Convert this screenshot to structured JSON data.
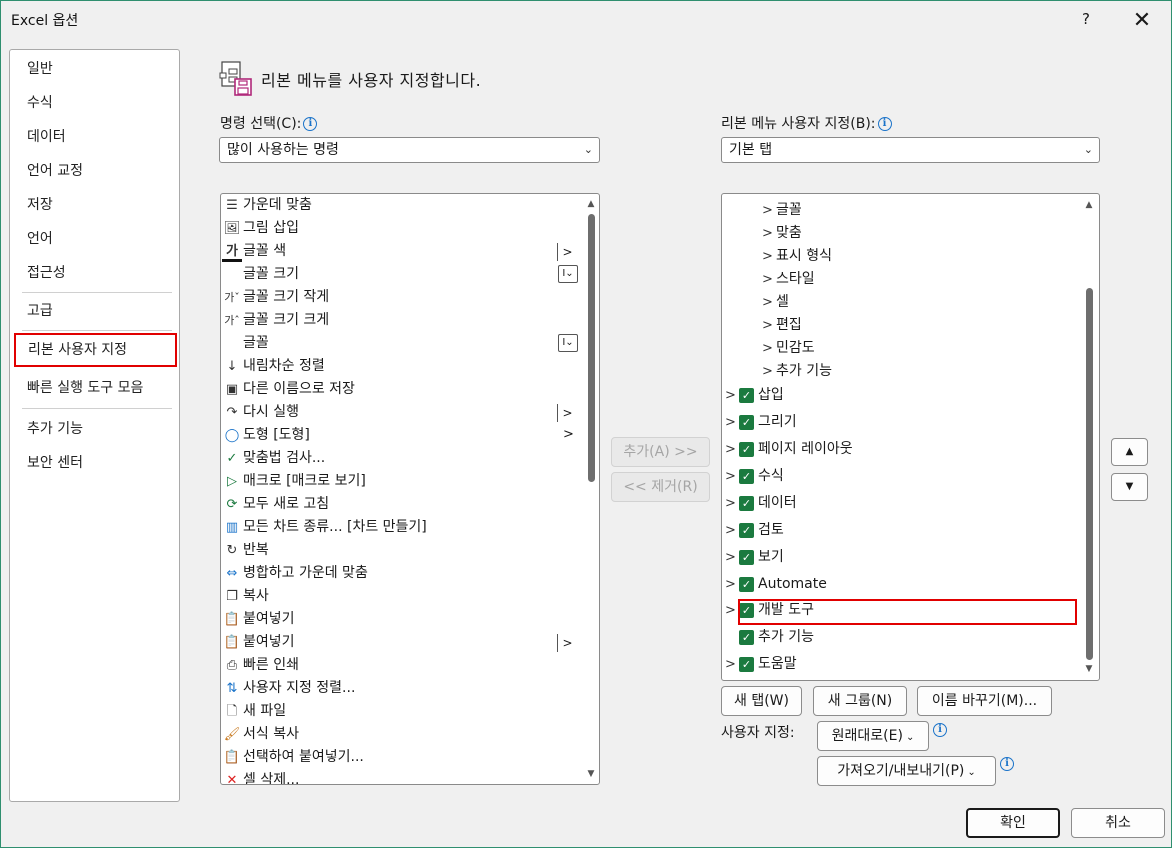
{
  "window": {
    "title": "Excel 옵션",
    "help": "?",
    "close": "✕"
  },
  "nav": {
    "items": [
      {
        "label": "일반"
      },
      {
        "label": "수식"
      },
      {
        "label": "데이터"
      },
      {
        "label": "언어 교정"
      },
      {
        "label": "저장"
      },
      {
        "label": "언어"
      },
      {
        "label": "접근성"
      },
      {
        "label": "고급"
      },
      {
        "label": "리본 사용자 지정"
      },
      {
        "label": "빠른 실행 도구 모음"
      },
      {
        "label": "추가 기능"
      },
      {
        "label": "보안 센터"
      }
    ],
    "selected": "리본 사용자 지정"
  },
  "header": {
    "text": "리본 메뉴를 사용자 지정합니다."
  },
  "commands": {
    "label": "명령 선택(C):",
    "dropdown_value": "많이 사용하는 명령",
    "items": [
      {
        "label": "가운데 맞춤",
        "icon": "align-center-icon",
        "glyph": "☰"
      },
      {
        "label": "그림 삽입",
        "icon": "insert-picture-icon",
        "glyph": "🖼"
      },
      {
        "label": "글꼴 색",
        "icon": "font-color-icon",
        "glyph": "가"
      },
      {
        "label": "글꼴 크기",
        "icon": "",
        "glyph": ""
      },
      {
        "label": "글꼴 크기 작게",
        "icon": "decrease-font-icon",
        "glyph": "가ˇ"
      },
      {
        "label": "글꼴 크기 크게",
        "icon": "increase-font-icon",
        "glyph": "가ˆ"
      },
      {
        "label": "글꼴",
        "icon": "",
        "glyph": ""
      },
      {
        "label": "내림차순 정렬",
        "icon": "sort-descending-icon",
        "glyph": "↓"
      },
      {
        "label": "다른 이름으로 저장",
        "icon": "save-as-icon",
        "glyph": "▣"
      },
      {
        "label": "다시 실행",
        "icon": "redo-icon",
        "glyph": "↷"
      },
      {
        "label": "도형 [도형]",
        "icon": "shapes-icon",
        "glyph": "◯"
      },
      {
        "label": "맞춤법 검사...",
        "icon": "spelling-icon",
        "glyph": "✓"
      },
      {
        "label": "매크로 [매크로 보기]",
        "icon": "macro-icon",
        "glyph": "▷"
      },
      {
        "label": "모두 새로 고침",
        "icon": "refresh-all-icon",
        "glyph": "⟳"
      },
      {
        "label": "모든 차트 종류... [차트 만들기]",
        "icon": "chart-icon",
        "glyph": "▥"
      },
      {
        "label": "반복",
        "icon": "repeat-icon",
        "glyph": "↻"
      },
      {
        "label": "병합하고 가운데 맞춤",
        "icon": "merge-center-icon",
        "glyph": "⇔"
      },
      {
        "label": "복사",
        "icon": "copy-icon",
        "glyph": "❐"
      },
      {
        "label": "붙여넣기",
        "icon": "paste-icon",
        "glyph": "📋"
      },
      {
        "label": "붙여넣기",
        "icon": "paste-icon",
        "glyph": "📋"
      },
      {
        "label": "빠른 인쇄",
        "icon": "quick-print-icon",
        "glyph": "⎙"
      },
      {
        "label": "사용자 지정 정렬...",
        "icon": "custom-sort-icon",
        "glyph": "⇅"
      },
      {
        "label": "새 파일",
        "icon": "new-file-icon",
        "glyph": "🗋"
      },
      {
        "label": "서식 복사",
        "icon": "format-painter-icon",
        "glyph": "🖌"
      },
      {
        "label": "선택하여 붙여넣기...",
        "icon": "paste-special-icon",
        "glyph": "📋"
      },
      {
        "label": "셀 삭제...",
        "icon": "delete-cells-icon",
        "glyph": "✕"
      }
    ]
  },
  "ribbon": {
    "label": "리본 메뉴 사용자 지정(B):",
    "dropdown_value": "기본 탭",
    "groups": [
      {
        "label": "글꼴"
      },
      {
        "label": "맞춤"
      },
      {
        "label": "표시 형식"
      },
      {
        "label": "스타일"
      },
      {
        "label": "셀"
      },
      {
        "label": "편집"
      },
      {
        "label": "민감도"
      },
      {
        "label": "추가 기능"
      }
    ],
    "tabs": [
      {
        "label": "삽입"
      },
      {
        "label": "그리기"
      },
      {
        "label": "페이지 레이아웃"
      },
      {
        "label": "수식"
      },
      {
        "label": "데이터"
      },
      {
        "label": "검토"
      },
      {
        "label": "보기"
      },
      {
        "label": "Automate"
      },
      {
        "label": "개발 도구"
      },
      {
        "label": "추가 기능"
      },
      {
        "label": "도움말"
      }
    ]
  },
  "buttons": {
    "add": "추가(A) >>",
    "remove": "<< 제거(R)",
    "new_tab": "새 탭(W)",
    "new_group": "새 그룹(N)",
    "rename": "이름 바꾸기(M)...",
    "customize_label": "사용자 지정:",
    "reset": "원래대로(E)",
    "import_export": "가져오기/내보내기(P)",
    "ok": "확인",
    "cancel": "취소"
  },
  "colors": {
    "accent_green": "#1b7a3f",
    "highlight_red": "#e10000",
    "info_blue": "#1a73c9"
  }
}
